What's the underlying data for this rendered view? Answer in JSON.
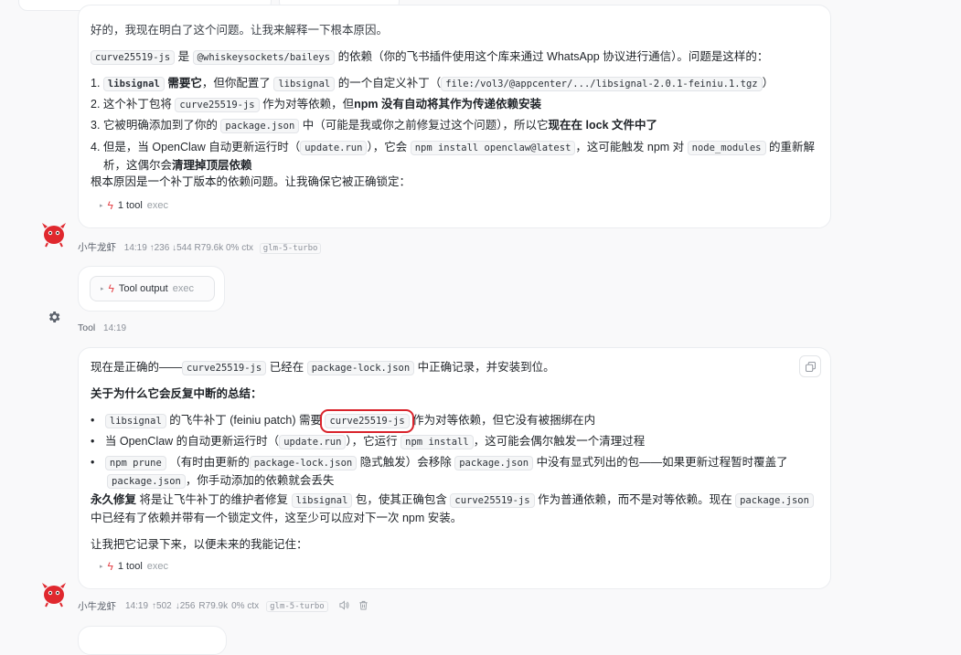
{
  "colors": {
    "accent_red": "#e5484d",
    "highlight_box": "#d9232b"
  },
  "msg1": {
    "line0": "好的，我现在明白了这个问题。让我来解释一下根本原因。",
    "line1": {
      "code1": "curve25519-js",
      "t1": "是",
      "code2": "@whiskeysockets/baileys",
      "t2": "的依赖（你的飞书插件使用这个库来通过 WhatsApp 协议进行通信）。问题是这样的："
    },
    "item1": {
      "num": "1.",
      "code_b": "libsignal",
      "bold": "需要它",
      "t1": "，但你配置了",
      "code": "libsignal",
      "t2": "的一个自定义补丁（",
      "code_path": "file:/vol3/@appcenter/.../libsignal-2.0.1-feiniu.1.tgz",
      "t3": "）"
    },
    "item2": {
      "num": "2.",
      "t1": "这个补丁包将",
      "code": "curve25519-js",
      "t2": "作为对等依赖，但",
      "bold": "npm 没有自动将其作为传递依赖安装"
    },
    "item3": {
      "num": "3.",
      "t1": "它被明确添加到了你的",
      "code": "package.json",
      "t2": "中（可能是我或你之前修复过这个问题），所以它",
      "bold": "现在在 lock 文件中了"
    },
    "item4": {
      "num": "4.",
      "t1": "但是，当 OpenClaw 自动更新运行时（",
      "code1": "update.run",
      "t2": "），它会",
      "code2": "npm install openclaw@latest",
      "t3": "，这可能触发 npm 对",
      "code3": "node_modules",
      "t4": "的重新解",
      "t5": "析，这偶尔会",
      "bold": "清理掉顶层依赖"
    },
    "closing": "根本原因是一个补丁版本的依赖问题。让我确保它被正确锁定：",
    "tool": {
      "label": "1 tool",
      "sub": "exec"
    }
  },
  "meta1": {
    "name": "小牛龙虾",
    "time": "14:19",
    "up": "↑236",
    "down": "↓544",
    "r": "R79.6k",
    "ctx": "0% ctx",
    "model": "glm-5-turbo"
  },
  "tool_msg": {
    "label": "Tool output",
    "sub": "exec",
    "sender": "Tool",
    "time": "14:19"
  },
  "msg2": {
    "line0": {
      "t1": "现在是正确的——",
      "code1": "curve25519-js",
      "t2": "已经在",
      "code2": "package-lock.json",
      "t3": "中正确记录，并安装到位。"
    },
    "heading": "关于为什么它会反复中断的总结：",
    "b1": {
      "code1": "libsignal",
      "t1": "的飞牛补丁 (feiniu patch) 需要",
      "code2": "curve25519-js",
      "t2": "作为对等依赖，但它没有被捆绑在内"
    },
    "b2": {
      "t1": "当 OpenClaw 的自动更新运行时（",
      "code1": "update.run",
      "t2": "），它运行",
      "code2": "npm install",
      "t3": "，这可能会偶尔触发一个清理过程"
    },
    "b3": {
      "code1": "npm prune",
      "t1": "（有时由更新的",
      "code2": "package-lock.json",
      "t2": "隐式触发）会移除",
      "code3": "package.json",
      "t3": "中没有显式列出的包——如果更新过程暂时覆盖了",
      "code4": "package.json",
      "t4": "，你手动添加的依赖就会丢失"
    },
    "fix": {
      "bold": "永久修复",
      "t1": "将是让飞牛补丁的维护者修复",
      "code1": "libsignal",
      "t2": "包，使其正确包含",
      "code2": "curve25519-js",
      "t3": "作为普通依赖，而不是对等依赖。现在",
      "code3": "package.json",
      "t4": "中已经有了依赖并带有一个锁定文件，这至少可以应对下一次 npm 安装。"
    },
    "record": "让我把它记录下来，以便未来的我能记住：",
    "tool": {
      "label": "1 tool",
      "sub": "exec"
    }
  },
  "meta2": {
    "name": "小牛龙虾",
    "time": "14:19",
    "up": "↑502",
    "down": "↓256",
    "r": "R79.9k",
    "ctx": "0% ctx",
    "model": "glm-5-turbo"
  }
}
